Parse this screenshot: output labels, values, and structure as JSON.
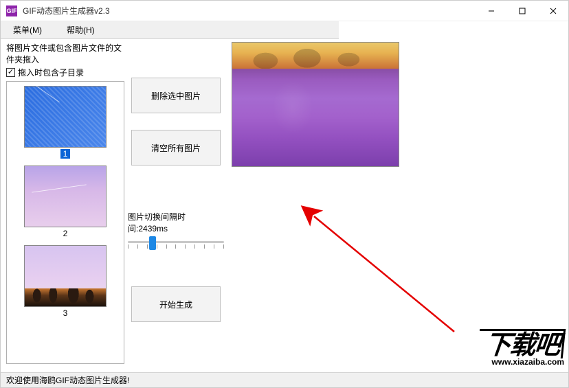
{
  "window": {
    "title": "GIF动态图片生成器v2.3",
    "icon_label": "GIF"
  },
  "menubar": {
    "menu": "菜单(M)",
    "help": "帮助(H)"
  },
  "instruction": "将图片文件或包含图片文件的文件夹拖入",
  "checkbox": {
    "checked": true,
    "label": "拖入时包含子目录"
  },
  "thumbnails": [
    {
      "label": "1",
      "selected": true
    },
    {
      "label": "2",
      "selected": false
    },
    {
      "label": "3",
      "selected": false
    }
  ],
  "buttons": {
    "delete_selected": "删除选中图片",
    "clear_all": "清空所有图片",
    "start": "开始生成"
  },
  "interval": {
    "label_prefix": "图片切换间隔时间:",
    "value_text": "2439ms",
    "slider_percent": 22
  },
  "status": "欢迎使用海鸥GIF动态图片生成器!",
  "watermark": {
    "big": "下载吧",
    "url": "www.xiazaiba.com"
  }
}
